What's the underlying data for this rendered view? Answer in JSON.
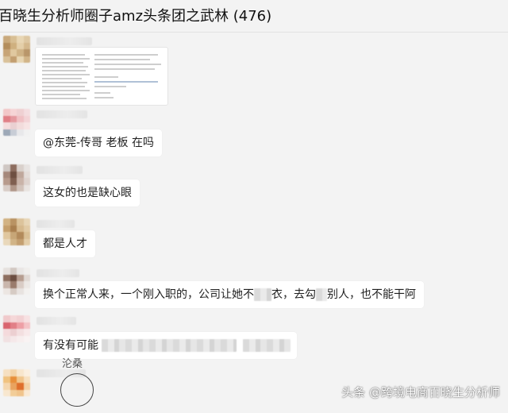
{
  "window": {
    "title": "百晓生分析师圈子amz头条团之武林 (476)"
  },
  "messages": [
    {
      "type": "image"
    },
    {
      "type": "text",
      "text": "@东莞-传哥  老板 在吗"
    },
    {
      "type": "text",
      "text": "这女的也是缺心眼"
    },
    {
      "type": "text",
      "text": "都是人才"
    },
    {
      "type": "text",
      "parts": [
        "换个正常人来，一个刚入职的，公司让她不",
        "衣，去勾",
        "别人，也不能干阿"
      ]
    },
    {
      "type": "text",
      "parts": [
        "有没有可能"
      ]
    },
    {
      "type": "partial",
      "text": "沦桑"
    }
  ],
  "watermark": "头条 @跨境电商百晓生分析师",
  "colors": {
    "background": "#f3f3f3",
    "bubble": "#ffffff"
  }
}
